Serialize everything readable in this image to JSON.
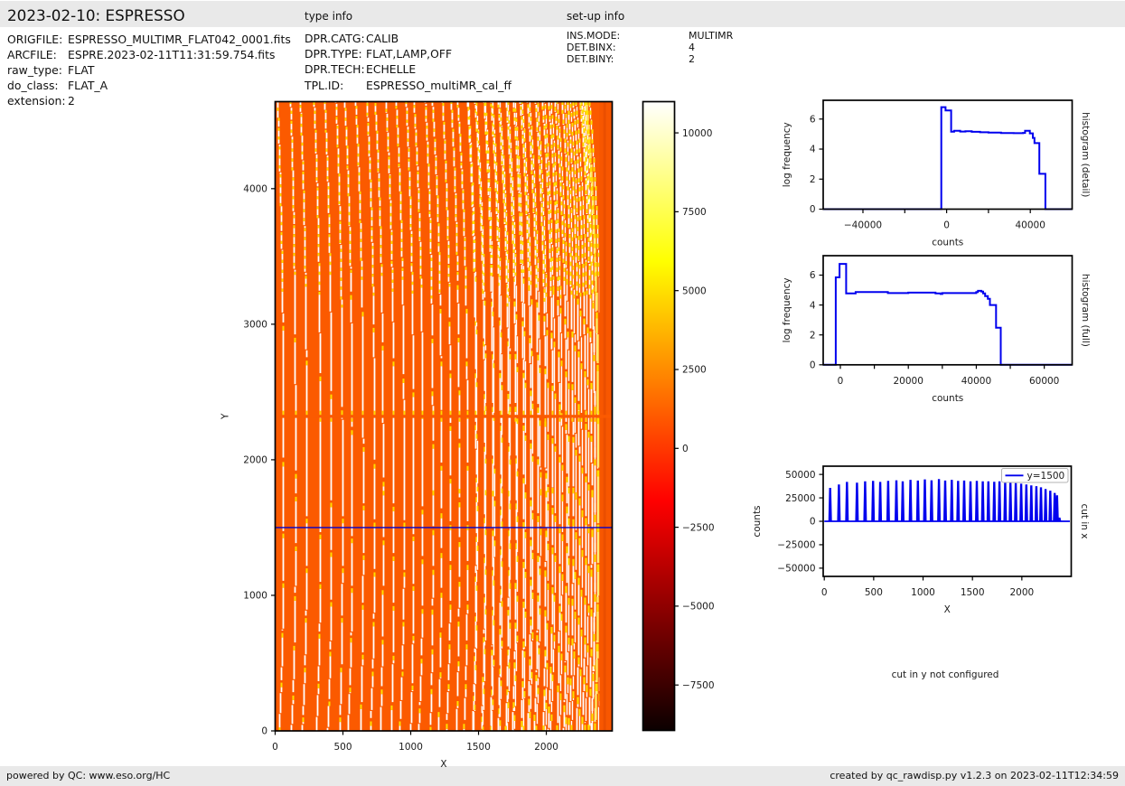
{
  "header": {
    "title": "2023-02-10: ESPRESSO",
    "type_info_label": "type info",
    "setup_info_label": "set-up info"
  },
  "file_info": {
    "rows": [
      {
        "label": "ORIGFILE:",
        "value": "ESPRESSO_MULTIMR_FLAT042_0001.fits"
      },
      {
        "label": "ARCFILE:",
        "value": "ESPRE.2023-02-11T11:31:59.754.fits"
      },
      {
        "label": "raw_type:",
        "value": "FLAT"
      },
      {
        "label": "do_class:",
        "value": "FLAT_A"
      },
      {
        "label": "extension:",
        "value": "2"
      }
    ]
  },
  "type_info": {
    "rows": [
      {
        "label": "DPR.CATG:",
        "value": "CALIB"
      },
      {
        "label": "DPR.TYPE:",
        "value": "FLAT,LAMP,OFF"
      },
      {
        "label": "DPR.TECH:",
        "value": "ECHELLE"
      },
      {
        "label": "TPL.ID:",
        "value": "ESPRESSO_multiMR_cal_ff"
      }
    ]
  },
  "setup_info": {
    "rows": [
      {
        "label": "INS.MODE:",
        "value": "MULTIMR"
      },
      {
        "label": "DET.BINX:",
        "value": "4"
      },
      {
        "label": "DET.BINY:",
        "value": "2"
      }
    ]
  },
  "footer": {
    "left": "powered by QC: www.eso.org/HC",
    "right": "created by qc_rawdisp.py v1.2.3 on 2023-02-11T12:34:59"
  },
  "colors": {
    "band": "#e9e9e9",
    "flat_background": "#fb5a00",
    "stripe": "#ffffff",
    "stripe_accent": "#ffd900",
    "line_blue": "#0000ee",
    "cut_line": "#0000cc",
    "axis": "#000000"
  },
  "chart_data": [
    {
      "id": "main_image",
      "type": "heatmap",
      "xlabel": "X",
      "ylabel": "Y",
      "xlim": [
        0,
        2486
      ],
      "ylim": [
        0,
        4642
      ],
      "xticks": [
        0,
        500,
        1000,
        1500,
        2000
      ],
      "yticks": [
        0,
        1000,
        2000,
        3000,
        4000
      ],
      "cut_line_y": 1500,
      "detector_gap_y": 2320,
      "order_traces_x": [
        59,
        148,
        230,
        331,
        413,
        494,
        566,
        647,
        730,
        794,
        873,
        948,
        1018,
        1086,
        1161,
        1224,
        1291,
        1355,
        1416,
        1480,
        1544,
        1604,
        1661,
        1721,
        1774,
        1831,
        1884,
        1938,
        1993,
        2045,
        2096,
        2147,
        2194,
        2240,
        2288,
        2333,
        2356,
        2381
      ],
      "note": "echelle flat-field raster: orange background with white order traces and yellow accents"
    },
    {
      "id": "colorbar",
      "type": "colorbar",
      "colormap": "hot",
      "vmin": -8940,
      "vmax": 10990,
      "ticks": [
        10000,
        7500,
        5000,
        2500,
        0,
        -2500,
        -5000,
        -7500
      ],
      "tick_labels": [
        "10000",
        "7500",
        "5000",
        "2500",
        "0",
        "−2500",
        "−5000",
        "−7500"
      ]
    },
    {
      "id": "hist_detail",
      "type": "line",
      "xlabel": "counts",
      "ylabel": "log frequency",
      "right_label": "histogram (detail)",
      "xlim": [
        -59000,
        60000
      ],
      "ylim": [
        0,
        7.25
      ],
      "xticks": [
        -40000,
        -20000,
        0,
        20000,
        40000
      ],
      "xtick_labels": [
        "−40000",
        "",
        "0",
        "",
        "40000"
      ],
      "yticks": [
        0,
        2,
        4,
        6
      ],
      "steps": [
        [
          -59000,
          0
        ],
        [
          -2554,
          0
        ],
        [
          -2554,
          6.79
        ],
        [
          -519,
          6.79
        ],
        [
          -519,
          6.57
        ],
        [
          2164,
          6.57
        ],
        [
          2164,
          5.16
        ],
        [
          3600,
          5.16
        ],
        [
          3600,
          5.22
        ],
        [
          6500,
          5.22
        ],
        [
          6500,
          5.17
        ],
        [
          9000,
          5.19
        ],
        [
          12000,
          5.15
        ],
        [
          16000,
          5.12
        ],
        [
          20000,
          5.1
        ],
        [
          26000,
          5.07
        ],
        [
          32000,
          5.06
        ],
        [
          36500,
          5.08
        ],
        [
          37500,
          5.08
        ],
        [
          37500,
          5.22
        ],
        [
          39800,
          5.22
        ],
        [
          39800,
          5.05
        ],
        [
          41200,
          5.05
        ],
        [
          41200,
          4.75
        ],
        [
          42000,
          4.75
        ],
        [
          42000,
          4.4
        ],
        [
          44300,
          4.4
        ],
        [
          44300,
          2.35
        ],
        [
          47200,
          2.35
        ],
        [
          47200,
          0
        ],
        [
          60000,
          0
        ]
      ]
    },
    {
      "id": "hist_full",
      "type": "line",
      "xlabel": "counts",
      "ylabel": "log frequency",
      "right_label": "histogram (full)",
      "xlim": [
        -5050,
        68200
      ],
      "ylim": [
        0,
        7.3
      ],
      "xticks": [
        0,
        10000,
        20000,
        30000,
        40000,
        50000,
        60000
      ],
      "xtick_labels": [
        "0",
        "",
        "20000",
        "",
        "40000",
        "",
        "60000"
      ],
      "yticks": [
        0,
        2,
        4,
        6
      ],
      "steps": [
        [
          -5050,
          0
        ],
        [
          -1356,
          0
        ],
        [
          -1356,
          5.85
        ],
        [
          -240,
          5.85
        ],
        [
          -240,
          6.75
        ],
        [
          1700,
          6.75
        ],
        [
          1700,
          4.78
        ],
        [
          4500,
          4.78
        ],
        [
          4500,
          4.87
        ],
        [
          14000,
          4.87
        ],
        [
          14000,
          4.8
        ],
        [
          20000,
          4.83
        ],
        [
          28000,
          4.78
        ],
        [
          29500,
          4.74
        ],
        [
          30000,
          4.8
        ],
        [
          40000,
          4.87
        ],
        [
          40500,
          4.95
        ],
        [
          41500,
          4.9
        ],
        [
          42000,
          4.78
        ],
        [
          42600,
          4.78
        ],
        [
          42600,
          4.6
        ],
        [
          43400,
          4.6
        ],
        [
          43400,
          4.42
        ],
        [
          44000,
          4.42
        ],
        [
          44000,
          4.0
        ],
        [
          45800,
          4.0
        ],
        [
          45800,
          2.48
        ],
        [
          47200,
          2.48
        ],
        [
          47200,
          0
        ],
        [
          68200,
          0
        ]
      ]
    },
    {
      "id": "cut_x",
      "type": "spikes",
      "xlabel": "X",
      "ylabel": "counts",
      "right_label": "cut in x",
      "legend": "y=1500",
      "xlim": [
        -11,
        2500
      ],
      "ylim": [
        -58800,
        58800
      ],
      "xticks": [
        0,
        500,
        1000,
        1500,
        2000
      ],
      "yticks": [
        50000,
        25000,
        0,
        -25000,
        -50000
      ],
      "ytick_labels": [
        "50000",
        "25000",
        "0",
        "−25000",
        "−50000"
      ],
      "baseline": [
        0,
        2486
      ],
      "spikes": [
        [
          59,
          35700
        ],
        [
          148,
          39300
        ],
        [
          230,
          42000
        ],
        [
          331,
          41300
        ],
        [
          413,
          42700
        ],
        [
          494,
          43100
        ],
        [
          566,
          42000
        ],
        [
          647,
          43100
        ],
        [
          730,
          43800
        ],
        [
          794,
          42700
        ],
        [
          873,
          44200
        ],
        [
          948,
          43500
        ],
        [
          1018,
          44700
        ],
        [
          1086,
          43800
        ],
        [
          1161,
          45100
        ],
        [
          1224,
          43500
        ],
        [
          1291,
          44200
        ],
        [
          1355,
          43100
        ],
        [
          1416,
          43500
        ],
        [
          1480,
          42700
        ],
        [
          1544,
          43100
        ],
        [
          1604,
          42700
        ],
        [
          1661,
          42700
        ],
        [
          1721,
          42200
        ],
        [
          1774,
          42700
        ],
        [
          1831,
          42200
        ],
        [
          1884,
          41500
        ],
        [
          1938,
          40800
        ],
        [
          1993,
          40100
        ],
        [
          2045,
          39300
        ],
        [
          2096,
          38400
        ],
        [
          2147,
          37500
        ],
        [
          2194,
          36200
        ],
        [
          2240,
          34500
        ],
        [
          2288,
          32700
        ],
        [
          2333,
          30300
        ],
        [
          2356,
          27800
        ],
        [
          2381,
          4000
        ]
      ]
    },
    {
      "id": "cut_y_note",
      "type": "text",
      "note": "cut in y not configured"
    }
  ]
}
